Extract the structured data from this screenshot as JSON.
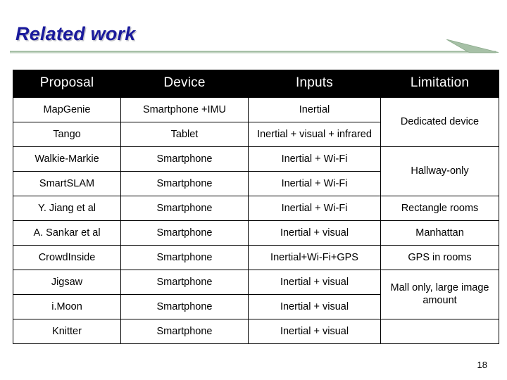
{
  "slide": {
    "title": "Related work",
    "page_number": "18",
    "accent_color": "#9cb89c",
    "title_color": "#1a1a9c"
  },
  "table": {
    "headers": [
      "Proposal",
      "Device",
      "Inputs",
      "Limitation"
    ],
    "rows": [
      {
        "proposal": "MapGenie",
        "device": "Smartphone +IMU",
        "inputs": "Inertial",
        "limitation": "Dedicated device",
        "limitation_rowspan": 2
      },
      {
        "proposal": "Tango",
        "device": "Tablet",
        "inputs": "Inertial + visual + infrared",
        "limitation": null
      },
      {
        "proposal": "Walkie-Markie",
        "device": "Smartphone",
        "inputs": "Inertial + Wi-Fi",
        "limitation": "Hallway-only",
        "limitation_rowspan": 2
      },
      {
        "proposal": "SmartSLAM",
        "device": "Smartphone",
        "inputs": "Inertial + Wi-Fi",
        "limitation": null
      },
      {
        "proposal": "Y. Jiang et al",
        "device": "Smartphone",
        "inputs": "Inertial + Wi-Fi",
        "limitation": "Rectangle rooms",
        "limitation_rowspan": 1
      },
      {
        "proposal": "A. Sankar et al",
        "device": "Smartphone",
        "inputs": "Inertial + visual",
        "limitation": "Manhattan",
        "limitation_rowspan": 1
      },
      {
        "proposal": "CrowdInside",
        "device": "Smartphone",
        "inputs": "Inertial+Wi-Fi+GPS",
        "limitation": "GPS in rooms",
        "limitation_rowspan": 1
      },
      {
        "proposal": "Jigsaw",
        "device": "Smartphone",
        "inputs": "Inertial + visual",
        "limitation": "Mall only, large image amount",
        "limitation_rowspan": 2
      },
      {
        "proposal": "i.Moon",
        "device": "Smartphone",
        "inputs": "Inertial + visual",
        "limitation": null
      },
      {
        "proposal": "Knitter",
        "device": "Smartphone",
        "inputs": "Inertial + visual",
        "limitation": "",
        "limitation_rowspan": 1
      }
    ]
  }
}
